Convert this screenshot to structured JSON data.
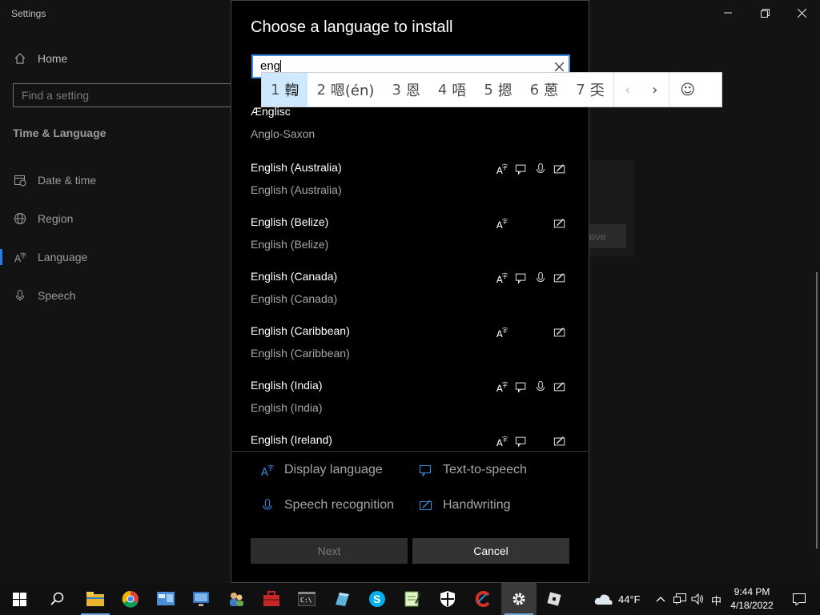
{
  "window": {
    "title": "Settings",
    "minimize_icon": "minimize-icon",
    "restore_icon": "restore-icon",
    "close_icon": "close-icon"
  },
  "sidebar": {
    "home_label": "Home",
    "search_placeholder": "Find a setting",
    "section_title": "Time & Language",
    "items": [
      {
        "label": "Date & time",
        "icon": "calendar-clock-icon"
      },
      {
        "label": "Region",
        "icon": "globe-icon"
      },
      {
        "label": "Language",
        "icon": "language-icon",
        "selected": true
      },
      {
        "label": "Speech",
        "icon": "microphone-icon"
      }
    ]
  },
  "background": {
    "partial_button_label": "ove"
  },
  "dialog": {
    "title": "Choose a language to install",
    "search_value": "eng",
    "languages": [
      {
        "name": "Ænglisc",
        "native": "Anglo-Saxon",
        "features": []
      },
      {
        "name": "English (Australia)",
        "native": "English (Australia)",
        "features": [
          "display",
          "tts",
          "speech",
          "handwriting"
        ]
      },
      {
        "name": "English (Belize)",
        "native": "English (Belize)",
        "features": [
          "display",
          "handwriting"
        ]
      },
      {
        "name": "English (Canada)",
        "native": "English (Canada)",
        "features": [
          "display",
          "tts",
          "speech",
          "handwriting"
        ]
      },
      {
        "name": "English (Caribbean)",
        "native": "English (Caribbean)",
        "features": [
          "display",
          "handwriting"
        ]
      },
      {
        "name": "English (India)",
        "native": "English (India)",
        "features": [
          "display",
          "tts",
          "speech",
          "handwriting"
        ]
      },
      {
        "name": "English (Ireland)",
        "native": "",
        "features": [
          "display",
          "tts",
          "handwriting"
        ]
      }
    ],
    "legend": {
      "display": "Display language",
      "tts": "Text-to-speech",
      "speech": "Speech recognition",
      "handwriting": "Handwriting"
    },
    "next_label": "Next",
    "cancel_label": "Cancel"
  },
  "ime": {
    "candidates": [
      {
        "num": "1",
        "text": "輷"
      },
      {
        "num": "2",
        "text": "嗯(én)"
      },
      {
        "num": "3",
        "text": "恩"
      },
      {
        "num": "4",
        "text": "唔"
      },
      {
        "num": "5",
        "text": "摁"
      },
      {
        "num": "6",
        "text": "蒽"
      },
      {
        "num": "7",
        "text": "奀"
      }
    ],
    "prev_label": "‹",
    "next_label": "›",
    "emoji_label": "☺"
  },
  "taskbar": {
    "weather_temp": "44°F",
    "ime_indicator": "中",
    "time": "9:44 PM",
    "date": "4/18/2022",
    "apps": [
      "start-icon",
      "search-icon",
      "file-explorer-icon",
      "chrome-icon",
      "control-panel-icon",
      "remote-desktop-icon",
      "users-icon",
      "toolbox-icon",
      "command-prompt-icon",
      "app-icon",
      "skype-icon",
      "notepad-icon",
      "security-icon",
      "ccleaner-icon",
      "settings-icon",
      "roblox-icon"
    ]
  }
}
